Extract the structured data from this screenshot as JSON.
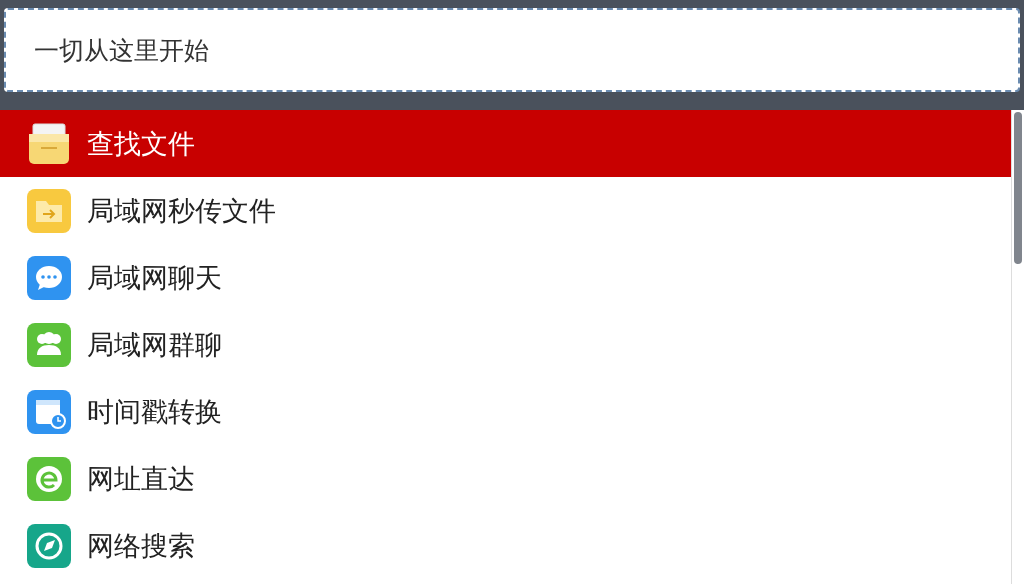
{
  "search": {
    "placeholder": "一切从这里开始"
  },
  "items": [
    {
      "label": "查找文件",
      "kind": "tray",
      "selected": true
    },
    {
      "label": "局域网秒传文件",
      "kind": "folder",
      "selected": false
    },
    {
      "label": "局域网聊天",
      "kind": "chat",
      "selected": false
    },
    {
      "label": "局域网群聊",
      "kind": "group",
      "selected": false
    },
    {
      "label": "时间戳转换",
      "kind": "calendar",
      "selected": false
    },
    {
      "label": "网址直达",
      "kind": "link",
      "selected": false
    },
    {
      "label": "网络搜索",
      "kind": "compass",
      "selected": false
    }
  ]
}
